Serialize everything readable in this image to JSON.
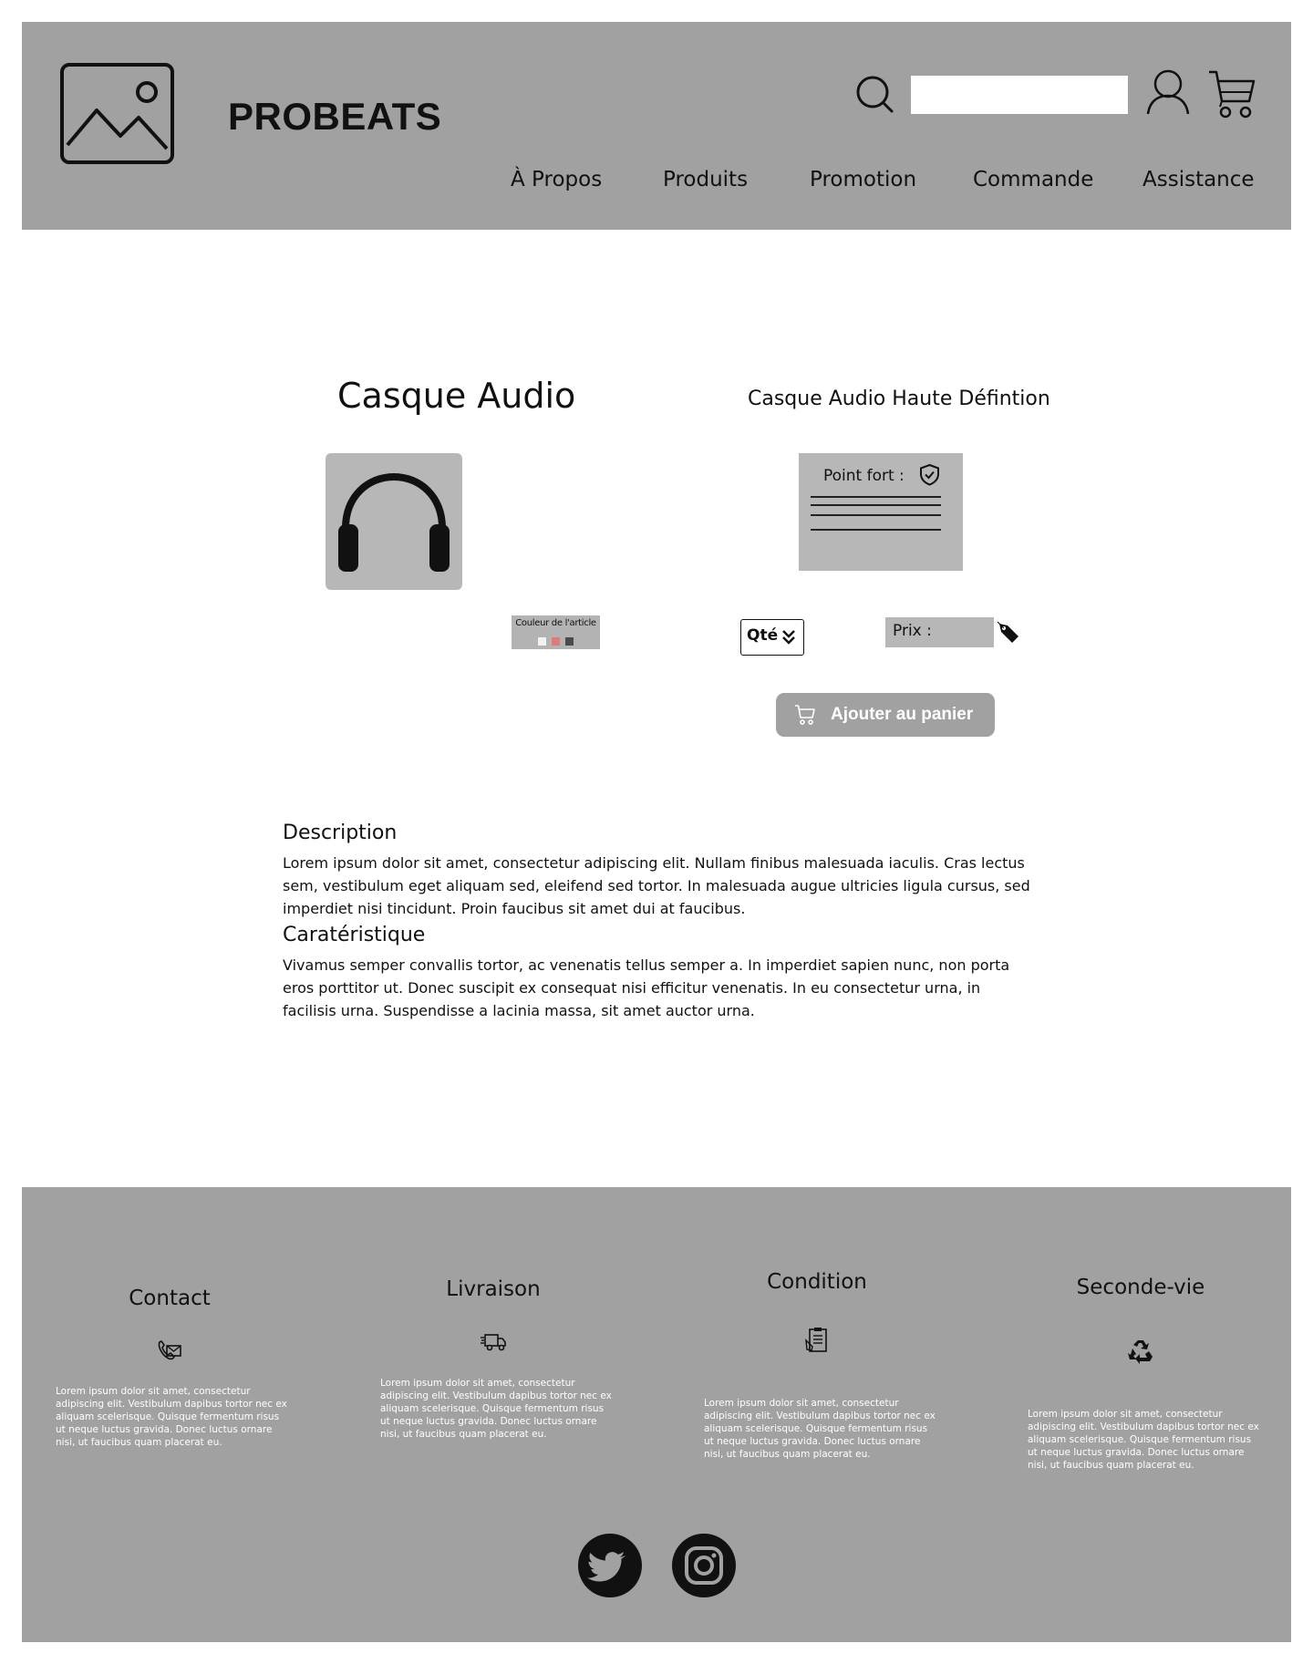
{
  "header": {
    "brand": "PROBEATS",
    "search": {
      "placeholder": "",
      "value": ""
    },
    "nav": [
      "À Propos",
      "Produits",
      "Promotion",
      "Commande",
      "Assistance"
    ]
  },
  "product": {
    "title": "Casque Audio",
    "subtitle": "Casque Audio Haute Défintion",
    "highlights_label": "Point fort :",
    "color_label": "Couleur de l'article",
    "color_swatches": [
      "#f2f2f2",
      "#e17a7a",
      "#4a4a4a"
    ],
    "quantity_label": "Qté",
    "price_label": "Prix :",
    "add_to_cart_label": "Ajouter au panier"
  },
  "description": {
    "heading": "Description",
    "text": "Lorem ipsum dolor sit amet, consectetur adipiscing elit. Nullam finibus malesuada iaculis. Cras lectus sem, vestibulum eget aliquam sed, eleifend sed tortor. In malesuada augue ultricies ligula cursus, sed imperdiet nisi tincidunt. Proin faucibus sit amet dui at faucibus."
  },
  "characteristics": {
    "heading": "Caratéristique",
    "text": "Vivamus semper convallis tortor, ac venenatis tellus semper a. In imperdiet sapien nunc, non porta eros porttitor ut. Donec suscipit ex consequat nisi efficitur venenatis. In eu consectetur urna, in facilisis urna. Suspendisse a lacinia massa, sit amet auctor urna."
  },
  "footer": {
    "columns": [
      {
        "title": "Contact",
        "icon": "contact-mail-phone-icon",
        "text": "Lorem ipsum dolor sit amet, consectetur adipiscing elit. Vestibulum dapibus tortor nec ex aliquam scelerisque. Quisque fermentum risus ut neque luctus gravida. Donec luctus ornare nisi, ut faucibus quam placerat eu."
      },
      {
        "title": "Livraison",
        "icon": "delivery-truck-icon",
        "text": "Lorem ipsum dolor sit amet, consectetur adipiscing elit. Vestibulum dapibus tortor nec ex aliquam scelerisque. Quisque fermentum risus ut neque luctus gravida. Donec luctus ornare nisi, ut faucibus quam placerat eu."
      },
      {
        "title": "Condition",
        "icon": "clipboard-conditions-icon",
        "text": "Lorem ipsum dolor sit amet, consectetur adipiscing elit. Vestibulum dapibus tortor nec ex aliquam scelerisque. Quisque fermentum risus ut neque luctus gravida. Donec luctus ornare nisi, ut faucibus quam placerat eu."
      },
      {
        "title": "Seconde-vie",
        "icon": "recycle-icon",
        "text": "Lorem ipsum dolor sit amet, consectetur adipiscing elit. Vestibulum dapibus tortor nec ex aliquam scelerisque. Quisque fermentum risus ut neque luctus gravida. Donec luctus ornare nisi, ut faucibus quam placerat eu."
      }
    ],
    "social": [
      "twitter-icon",
      "instagram-icon"
    ]
  },
  "colors": {
    "header_footer_bg": "#a1a1a1",
    "panel_bg": "#b7b7b7",
    "button_text": "#ffffff"
  }
}
